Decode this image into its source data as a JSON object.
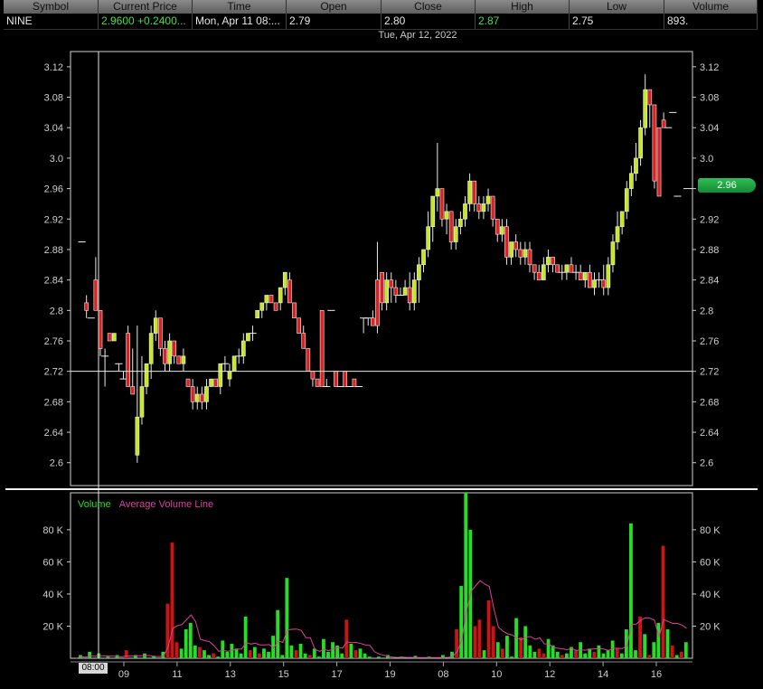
{
  "quote": {
    "headers": [
      "Symbol",
      "Current Price",
      "Time",
      "Open",
      "Close",
      "High",
      "Low",
      "Volume"
    ],
    "values": [
      "NINE",
      "2.9600  +0.2400...",
      "Mon, Apr 11  08:...",
      "2.79",
      "2.80",
      "2.87",
      "2.75",
      "893."
    ],
    "value_colors": [
      "#e6e6e6",
      "#46e046",
      "#e6e6e6",
      "#e6e6e6",
      "#e6e6e6",
      "#46e046",
      "#e6e6e6",
      "#e6e6e6"
    ]
  },
  "crosshair_date": "Tue, Apr 12, 2022",
  "current_price_badge": "2.96",
  "crosshair_time": "08:00",
  "legend": {
    "volume": "Volume",
    "average": "Average Volume Line"
  },
  "colors": {
    "up": "#c8e81e",
    "down": "#e02020",
    "vol_up": "#22e022",
    "vol_down": "#cc1414",
    "avg_line": "#e040a0"
  },
  "chart_data": [
    {
      "type": "candlestick",
      "y_ticks": [
        "3.12",
        "3.08",
        "3.04",
        "3.0",
        "2.96",
        "2.92",
        "2.88",
        "2.84",
        "2.8",
        "2.76",
        "2.72",
        "2.68",
        "2.64",
        "2.6"
      ],
      "ylim": [
        2.57,
        3.14
      ],
      "crosshair_price": 2.72,
      "current_price": 2.96,
      "candles": [
        [
          2.89,
          2.89,
          2.89,
          2.89
        ],
        [
          2.81,
          2.82,
          2.79,
          2.8
        ],
        [
          2.79,
          2.79,
          2.79,
          2.79
        ],
        [
          2.84,
          2.87,
          2.8,
          2.8
        ],
        [
          2.8,
          2.8,
          2.74,
          2.75
        ],
        [
          2.74,
          2.75,
          2.7,
          2.74
        ],
        [
          2.77,
          2.77,
          2.76,
          2.76
        ],
        [
          2.76,
          2.77,
          2.76,
          2.77
        ],
        [
          2.73,
          2.73,
          2.72,
          2.73
        ],
        [
          2.71,
          2.72,
          2.71,
          2.71
        ],
        [
          2.77,
          2.78,
          2.7,
          2.7
        ],
        [
          2.7,
          2.75,
          2.69,
          2.69
        ],
        [
          2.61,
          2.78,
          2.6,
          2.66
        ],
        [
          2.66,
          2.74,
          2.65,
          2.7
        ],
        [
          2.7,
          2.73,
          2.69,
          2.73
        ],
        [
          2.73,
          2.78,
          2.71,
          2.77
        ],
        [
          2.77,
          2.8,
          2.76,
          2.79
        ],
        [
          2.79,
          2.79,
          2.74,
          2.75
        ],
        [
          2.75,
          2.76,
          2.72,
          2.73
        ],
        [
          2.73,
          2.77,
          2.72,
          2.76
        ],
        [
          2.76,
          2.76,
          2.73,
          2.74
        ],
        [
          2.74,
          2.74,
          2.73,
          2.73
        ],
        [
          2.73,
          2.75,
          2.72,
          2.74
        ],
        [
          2.71,
          2.71,
          2.7,
          2.7
        ],
        [
          2.7,
          2.71,
          2.67,
          2.68
        ],
        [
          2.68,
          2.7,
          2.67,
          2.69
        ],
        [
          2.69,
          2.7,
          2.67,
          2.68
        ],
        [
          2.68,
          2.71,
          2.67,
          2.7
        ],
        [
          2.7,
          2.71,
          2.7,
          2.71
        ],
        [
          2.71,
          2.71,
          2.7,
          2.7
        ],
        [
          2.7,
          2.73,
          2.69,
          2.73
        ],
        [
          2.73,
          2.74,
          2.72,
          2.73
        ],
        [
          2.71,
          2.73,
          2.7,
          2.72
        ],
        [
          2.72,
          2.74,
          2.72,
          2.74
        ],
        [
          2.74,
          2.75,
          2.73,
          2.74
        ],
        [
          2.74,
          2.77,
          2.73,
          2.76
        ],
        [
          2.76,
          2.77,
          2.76,
          2.77
        ],
        [
          2.77,
          2.78,
          2.76,
          2.77
        ],
        [
          2.79,
          2.8,
          2.79,
          2.8
        ],
        [
          2.8,
          2.81,
          2.79,
          2.81
        ],
        [
          2.81,
          2.82,
          2.8,
          2.82
        ],
        [
          2.82,
          2.82,
          2.81,
          2.81
        ],
        [
          2.81,
          2.81,
          2.8,
          2.8
        ],
        [
          2.81,
          2.83,
          2.8,
          2.83
        ],
        [
          2.83,
          2.85,
          2.82,
          2.85
        ],
        [
          2.84,
          2.85,
          2.81,
          2.81
        ],
        [
          2.81,
          2.81,
          2.79,
          2.79
        ],
        [
          2.79,
          2.79,
          2.77,
          2.77
        ],
        [
          2.77,
          2.78,
          2.75,
          2.75
        ],
        [
          2.75,
          2.75,
          2.72,
          2.72
        ],
        [
          2.72,
          2.72,
          2.7,
          2.71
        ],
        [
          2.71,
          2.71,
          2.7,
          2.7
        ],
        [
          2.8,
          2.8,
          2.7,
          2.7
        ],
        [
          2.7,
          2.71,
          2.7,
          2.7
        ],
        [
          2.8,
          2.8,
          2.8,
          2.8
        ],
        [
          2.72,
          2.72,
          2.7,
          2.7
        ],
        [
          2.7,
          2.7,
          2.7,
          2.7
        ],
        [
          2.72,
          2.72,
          2.7,
          2.7
        ],
        [
          2.7,
          2.7,
          2.7,
          2.7
        ],
        [
          2.71,
          2.71,
          2.7,
          2.7
        ],
        [
          2.7,
          2.7,
          2.7,
          2.7
        ],
        [
          2.79,
          2.79,
          2.77,
          2.79
        ],
        [
          2.79,
          2.79,
          2.78,
          2.79
        ],
        [
          2.79,
          2.8,
          2.78,
          2.78
        ],
        [
          2.84,
          2.89,
          2.77,
          2.78
        ],
        [
          2.85,
          2.85,
          2.8,
          2.81
        ],
        [
          2.81,
          2.85,
          2.8,
          2.84
        ],
        [
          2.84,
          2.85,
          2.81,
          2.83
        ],
        [
          2.83,
          2.84,
          2.81,
          2.82
        ],
        [
          2.82,
          2.83,
          2.82,
          2.82
        ],
        [
          2.82,
          2.84,
          2.82,
          2.83
        ],
        [
          2.83,
          2.85,
          2.8,
          2.81
        ],
        [
          2.81,
          2.85,
          2.8,
          2.84
        ],
        [
          2.84,
          2.87,
          2.81,
          2.86
        ],
        [
          2.86,
          2.88,
          2.85,
          2.88
        ],
        [
          2.88,
          2.93,
          2.87,
          2.91
        ],
        [
          2.91,
          2.95,
          2.89,
          2.95
        ],
        [
          2.95,
          3.02,
          2.93,
          2.96
        ],
        [
          2.96,
          2.96,
          2.91,
          2.92
        ],
        [
          2.92,
          2.94,
          2.9,
          2.93
        ],
        [
          2.93,
          2.93,
          2.88,
          2.89
        ],
        [
          2.89,
          2.92,
          2.88,
          2.91
        ],
        [
          2.91,
          2.93,
          2.9,
          2.92
        ],
        [
          2.92,
          2.95,
          2.91,
          2.94
        ],
        [
          2.94,
          2.98,
          2.93,
          2.97
        ],
        [
          2.97,
          2.97,
          2.93,
          2.94
        ],
        [
          2.94,
          2.95,
          2.92,
          2.93
        ],
        [
          2.93,
          2.95,
          2.92,
          2.94
        ],
        [
          2.94,
          2.96,
          2.93,
          2.95
        ],
        [
          2.95,
          2.95,
          2.91,
          2.92
        ],
        [
          2.92,
          2.92,
          2.89,
          2.9
        ],
        [
          2.9,
          2.92,
          2.89,
          2.91
        ],
        [
          2.91,
          2.92,
          2.86,
          2.87
        ],
        [
          2.87,
          2.89,
          2.86,
          2.89
        ],
        [
          2.89,
          2.9,
          2.87,
          2.88
        ],
        [
          2.88,
          2.89,
          2.86,
          2.87
        ],
        [
          2.87,
          2.89,
          2.86,
          2.88
        ],
        [
          2.88,
          2.89,
          2.85,
          2.86
        ],
        [
          2.86,
          2.86,
          2.84,
          2.85
        ],
        [
          2.85,
          2.86,
          2.84,
          2.84
        ],
        [
          2.84,
          2.87,
          2.84,
          2.86
        ],
        [
          2.86,
          2.88,
          2.85,
          2.87
        ],
        [
          2.87,
          2.87,
          2.85,
          2.86
        ],
        [
          2.86,
          2.86,
          2.85,
          2.85
        ],
        [
          2.85,
          2.86,
          2.84,
          2.85
        ],
        [
          2.85,
          2.86,
          2.84,
          2.86
        ],
        [
          2.86,
          2.87,
          2.85,
          2.85
        ],
        [
          2.85,
          2.86,
          2.84,
          2.85
        ],
        [
          2.85,
          2.86,
          2.84,
          2.84
        ],
        [
          2.84,
          2.85,
          2.83,
          2.85
        ],
        [
          2.85,
          2.86,
          2.83,
          2.83
        ],
        [
          2.83,
          2.85,
          2.82,
          2.84
        ],
        [
          2.84,
          2.85,
          2.83,
          2.84
        ],
        [
          2.84,
          2.86,
          2.82,
          2.83
        ],
        [
          2.83,
          2.87,
          2.82,
          2.86
        ],
        [
          2.86,
          2.9,
          2.85,
          2.89
        ],
        [
          2.89,
          2.93,
          2.88,
          2.91
        ],
        [
          2.91,
          2.93,
          2.9,
          2.93
        ],
        [
          2.93,
          2.97,
          2.92,
          2.96
        ],
        [
          2.96,
          2.99,
          2.95,
          2.98
        ],
        [
          2.98,
          3.02,
          2.97,
          3.0
        ],
        [
          3.0,
          3.05,
          2.99,
          3.04
        ],
        [
          3.04,
          3.11,
          3.03,
          3.09
        ],
        [
          3.09,
          3.09,
          3.04,
          3.07
        ],
        [
          3.07,
          3.07,
          2.96,
          2.97
        ],
        [
          3.04,
          3.04,
          2.95,
          2.95
        ],
        [
          3.05,
          3.06,
          3.04,
          3.04
        ],
        [
          3.04,
          3.04,
          3.04,
          3.04
        ],
        [
          3.06,
          3.06,
          3.06,
          3.06
        ],
        [
          2.95,
          2.95,
          2.95,
          2.95
        ]
      ]
    },
    {
      "type": "bar",
      "y_ticks": [
        "80 K",
        "60 K",
        "40 K",
        "20 K"
      ],
      "ylim": [
        0,
        103000
      ],
      "x_ticks": [
        "09",
        "11",
        "13",
        "15",
        "17",
        "19",
        "08",
        "10",
        "12",
        "14",
        "16"
      ],
      "series": [
        {
          "name": "Volume",
          "values": [
            0,
            2000,
            0,
            4000,
            0,
            3000,
            0,
            1000,
            0,
            2000,
            0,
            5000,
            0,
            2000,
            0,
            3000,
            0,
            1500,
            0,
            4000,
            34000,
            72000,
            10000,
            6000,
            18000,
            22000,
            8000,
            7000,
            5000,
            2000,
            3000,
            1000,
            11000,
            4000,
            9000,
            6000,
            3000,
            26000,
            5000,
            7000,
            3000,
            6000,
            4000,
            14000,
            30000,
            2000,
            50000,
            8000,
            5000,
            9000,
            3000,
            2000,
            6000,
            1000,
            12000,
            4000,
            10000,
            8000,
            3000,
            24000,
            9000,
            5000,
            6000,
            3000,
            1000,
            0,
            1000,
            0,
            2000,
            0,
            0,
            1000,
            0,
            0,
            1500,
            0,
            0,
            1000,
            0,
            0,
            2000,
            0,
            4000,
            18000,
            45000,
            103000,
            80000,
            20000,
            24000,
            5000,
            36000,
            20000,
            10000,
            6000,
            14000,
            1000,
            25000,
            13000,
            20000,
            8000,
            4000,
            6000,
            3000,
            12000,
            8000,
            4000,
            2000,
            3000,
            7000,
            5000,
            10000,
            3000,
            6000,
            4000,
            8000,
            3000,
            5000,
            11000,
            6000,
            3000,
            18000,
            84000,
            5000,
            26000,
            15000,
            2000,
            10000,
            22000,
            70000,
            18000,
            8000,
            2000,
            4000,
            10000
          ],
          "down": [
            0,
            0,
            0,
            0,
            0,
            0,
            0,
            0,
            0,
            0,
            1,
            1,
            0,
            0,
            0,
            0,
            0,
            0,
            0,
            0,
            1,
            1,
            1,
            0,
            0,
            0,
            0,
            1,
            0,
            0,
            1,
            0,
            0,
            0,
            0,
            0,
            0,
            0,
            1,
            0,
            1,
            0,
            0,
            0,
            0,
            0,
            0,
            0,
            1,
            0,
            0,
            1,
            0,
            0,
            0,
            0,
            0,
            0,
            0,
            1,
            0,
            1,
            0,
            0,
            0,
            0,
            0,
            0,
            0,
            0,
            0,
            0,
            0,
            0,
            0,
            0,
            0,
            0,
            0,
            0,
            0,
            0,
            0,
            1,
            0,
            0,
            0,
            1,
            1,
            0,
            1,
            1,
            0,
            1,
            0,
            0,
            0,
            1,
            0,
            0,
            0,
            1,
            1,
            0,
            0,
            0,
            1,
            0,
            0,
            1,
            0,
            0,
            0,
            1,
            0,
            0,
            0,
            0,
            1,
            0,
            0,
            0,
            0,
            1,
            0,
            1,
            0,
            0,
            1,
            0,
            1,
            0,
            1,
            0,
            0,
            0
          ]
        },
        {
          "name": "Average Volume Line"
        }
      ]
    }
  ]
}
